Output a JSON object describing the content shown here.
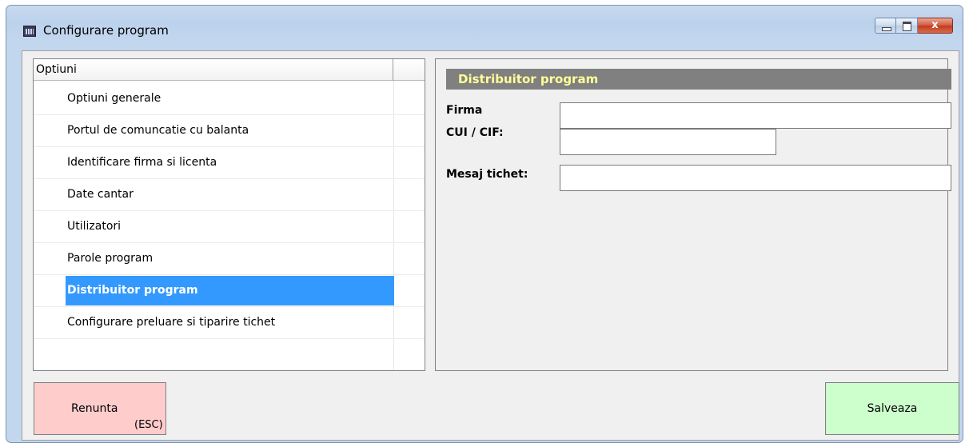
{
  "window": {
    "title": "Configurare program",
    "controls": {
      "minimize": "",
      "maximize": "",
      "close": "x"
    }
  },
  "options_list": {
    "header": "Optiuni",
    "items": [
      {
        "label": "Optiuni generale",
        "selected": false
      },
      {
        "label": "Portul de comuncatie cu balanta",
        "selected": false
      },
      {
        "label": "Identificare firma si licenta",
        "selected": false
      },
      {
        "label": "Date cantar",
        "selected": false
      },
      {
        "label": "Utilizatori",
        "selected": false
      },
      {
        "label": "Parole program",
        "selected": false
      },
      {
        "label": "Distribuitor program",
        "selected": true
      },
      {
        "label": "Configurare preluare si tiparire tichet",
        "selected": false
      }
    ]
  },
  "panel": {
    "title": "Distribuitor program",
    "fields": {
      "firma": {
        "label": "Firma",
        "value": ""
      },
      "cui": {
        "label": "CUI / CIF:",
        "value": ""
      },
      "mesaj": {
        "label": "Mesaj tichet:",
        "value": ""
      }
    }
  },
  "buttons": {
    "cancel": {
      "label": "Renunta",
      "shortcut": "(ESC)",
      "color": "#ffcccc"
    },
    "save": {
      "label": "Salveaza",
      "color": "#ccffcc"
    }
  },
  "colors": {
    "selection": "#3399ff",
    "panel_header_bg": "#808080",
    "panel_header_text": "#ffff99"
  }
}
